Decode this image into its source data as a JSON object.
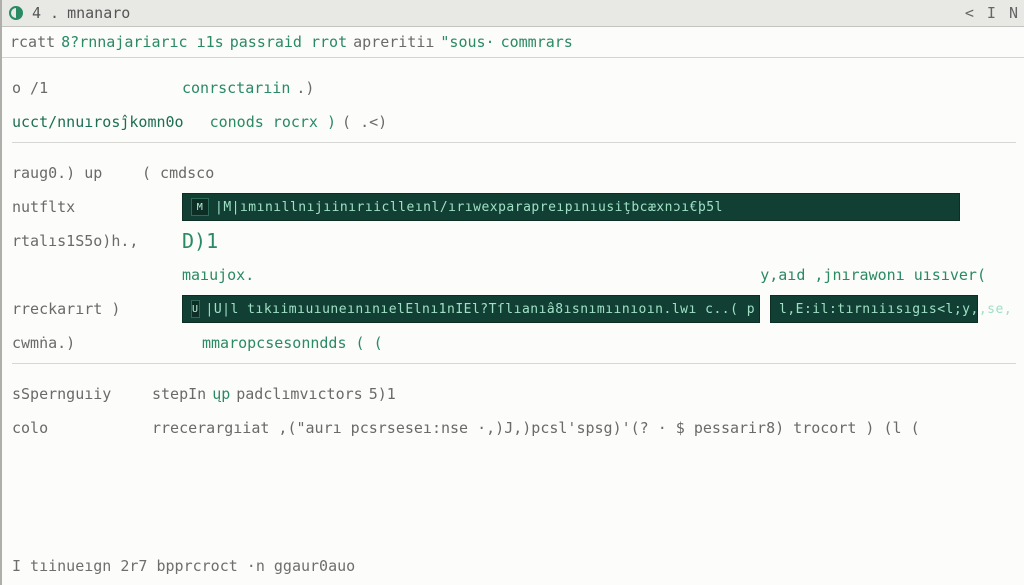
{
  "titlebar": {
    "num": "4 .",
    "title": "mnanaro",
    "right": "< I N"
  },
  "header": {
    "t1": "rcatt",
    "t2": "8?rnnajariarıc ı1s",
    "t3": "passraid rrot",
    "t4": "apreritiı",
    "q": "\"sous·",
    "t5": "commrars"
  },
  "rows": {
    "r1_a": "o /1",
    "r1_b": "conrsctarıin",
    "r1_c": ".)",
    "r2_a": "ucct/nnuırosĵkomn0o",
    "r2_b": "conods rocrx )",
    "r2_c": "( .<)",
    "r3_a": "raug0.) up",
    "r3_b": "( cmdsco",
    "r4_a": "nutfltx",
    "bar1": "|M|ımınıllnıjıinırıiclleınl/ırıwexparapreıpınıusiţbcæxnɔı€þ5l",
    "r5_a": "rtalıs1S5o)h.,",
    "r5_b": "D)1",
    "r6_a": "",
    "r6_b": "maıujox.",
    "r6_c": "y,aıd ,jnırawonı uısıver(",
    "r7_a": "rreckarırt  )",
    "bar2_left": "|U|l tıkıimıuıuneınınıelElnı1nIEl?Tſlıanıâ8ısnımıınıoın.lwı c..(  p",
    "bar2_right": "l,E:il:tırnıiısıgıs<l;y,,se,",
    "r8_a": "cwmṅa.)",
    "r8_b": "mmaropcsesonndds ( (",
    "r9_a": "sSpernguıiy",
    "r9_b": "stepIn",
    "r9_c": "ųp",
    "r9_d": "padclımvıctors",
    "r9_e": "5)1",
    "r10_a": "colo",
    "r10_b": "rrecerargıiat ,(\"aurı pcsrseseı:nse  ·,)J,)pcsl'spsg)'(? · $ pessarir8)  trocort ) (l (",
    "footer": "I tıinueıgn 2r7 bpprcroct    ·n   ggaur0auo"
  },
  "colors": {
    "green": "#2a8a64",
    "darkgreen": "#1d6f54",
    "barbg": "#123f33"
  }
}
